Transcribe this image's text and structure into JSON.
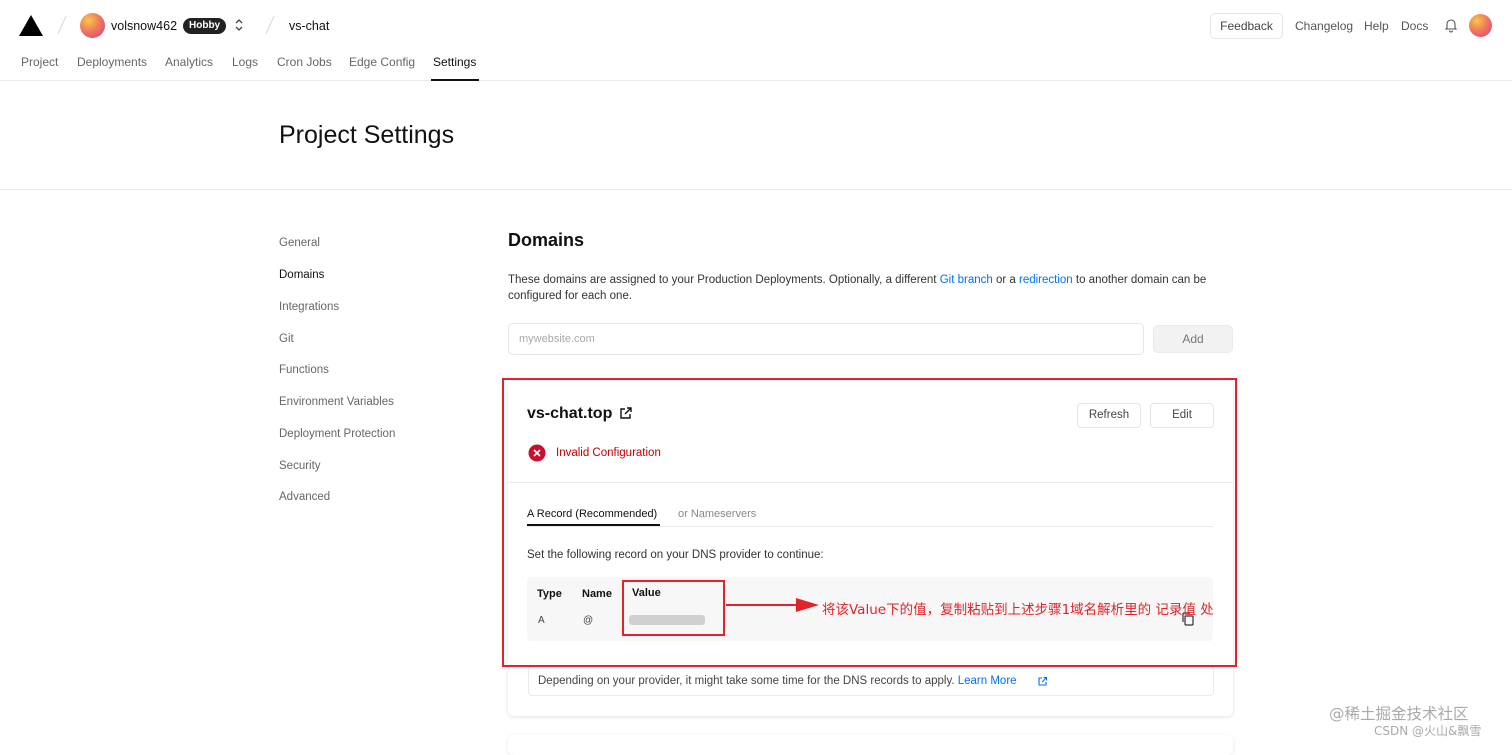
{
  "topbar": {
    "username": "volsnow462",
    "plan_badge": "Hobby",
    "project_name": "vs-chat",
    "feedback_label": "Feedback",
    "links": [
      "Changelog",
      "Help",
      "Docs"
    ]
  },
  "nav": {
    "tabs": [
      "Project",
      "Deployments",
      "Analytics",
      "Logs",
      "Cron Jobs",
      "Edge Config",
      "Settings"
    ],
    "active": "Settings"
  },
  "page": {
    "title": "Project Settings"
  },
  "sidebar": {
    "items": [
      "General",
      "Domains",
      "Integrations",
      "Git",
      "Functions",
      "Environment Variables",
      "Deployment Protection",
      "Security",
      "Advanced"
    ],
    "active": "Domains"
  },
  "domains": {
    "title": "Domains",
    "desc_part1": "These domains are assigned to your Production Deployments. Optionally, a different ",
    "desc_link1": "Git branch",
    "desc_part2": " or a ",
    "desc_link2": "redirection",
    "desc_part3": " to another domain can be configured for each one.",
    "input_placeholder": "mywebsite.com",
    "add_label": "Add"
  },
  "domain_card": {
    "domain": "vs-chat.top",
    "refresh_label": "Refresh",
    "edit_label": "Edit",
    "status": "Invalid Configuration",
    "tab_a": "A Record (Recommended)",
    "tab_b": "or Nameservers",
    "instruction": "Set the following record on your DNS provider to continue:",
    "record_headers": {
      "type": "Type",
      "name": "Name",
      "value": "Value"
    },
    "record": {
      "type": "A",
      "name": "@"
    },
    "note_text": "Depending on your provider, it might take some time for the DNS records to apply. ",
    "note_link": "Learn More"
  },
  "annotation": {
    "text": "将该Value下的值，复制粘贴到上述步骤1域名解析里的 记录值 处",
    "color": "#e0242b"
  },
  "watermark": {
    "line1": "@稀土掘金技术社区",
    "line2": "CSDN @火山&飘雪"
  },
  "colors": {
    "link": "#0070f3",
    "error": "#c00000",
    "badge_bg": "#222222"
  }
}
